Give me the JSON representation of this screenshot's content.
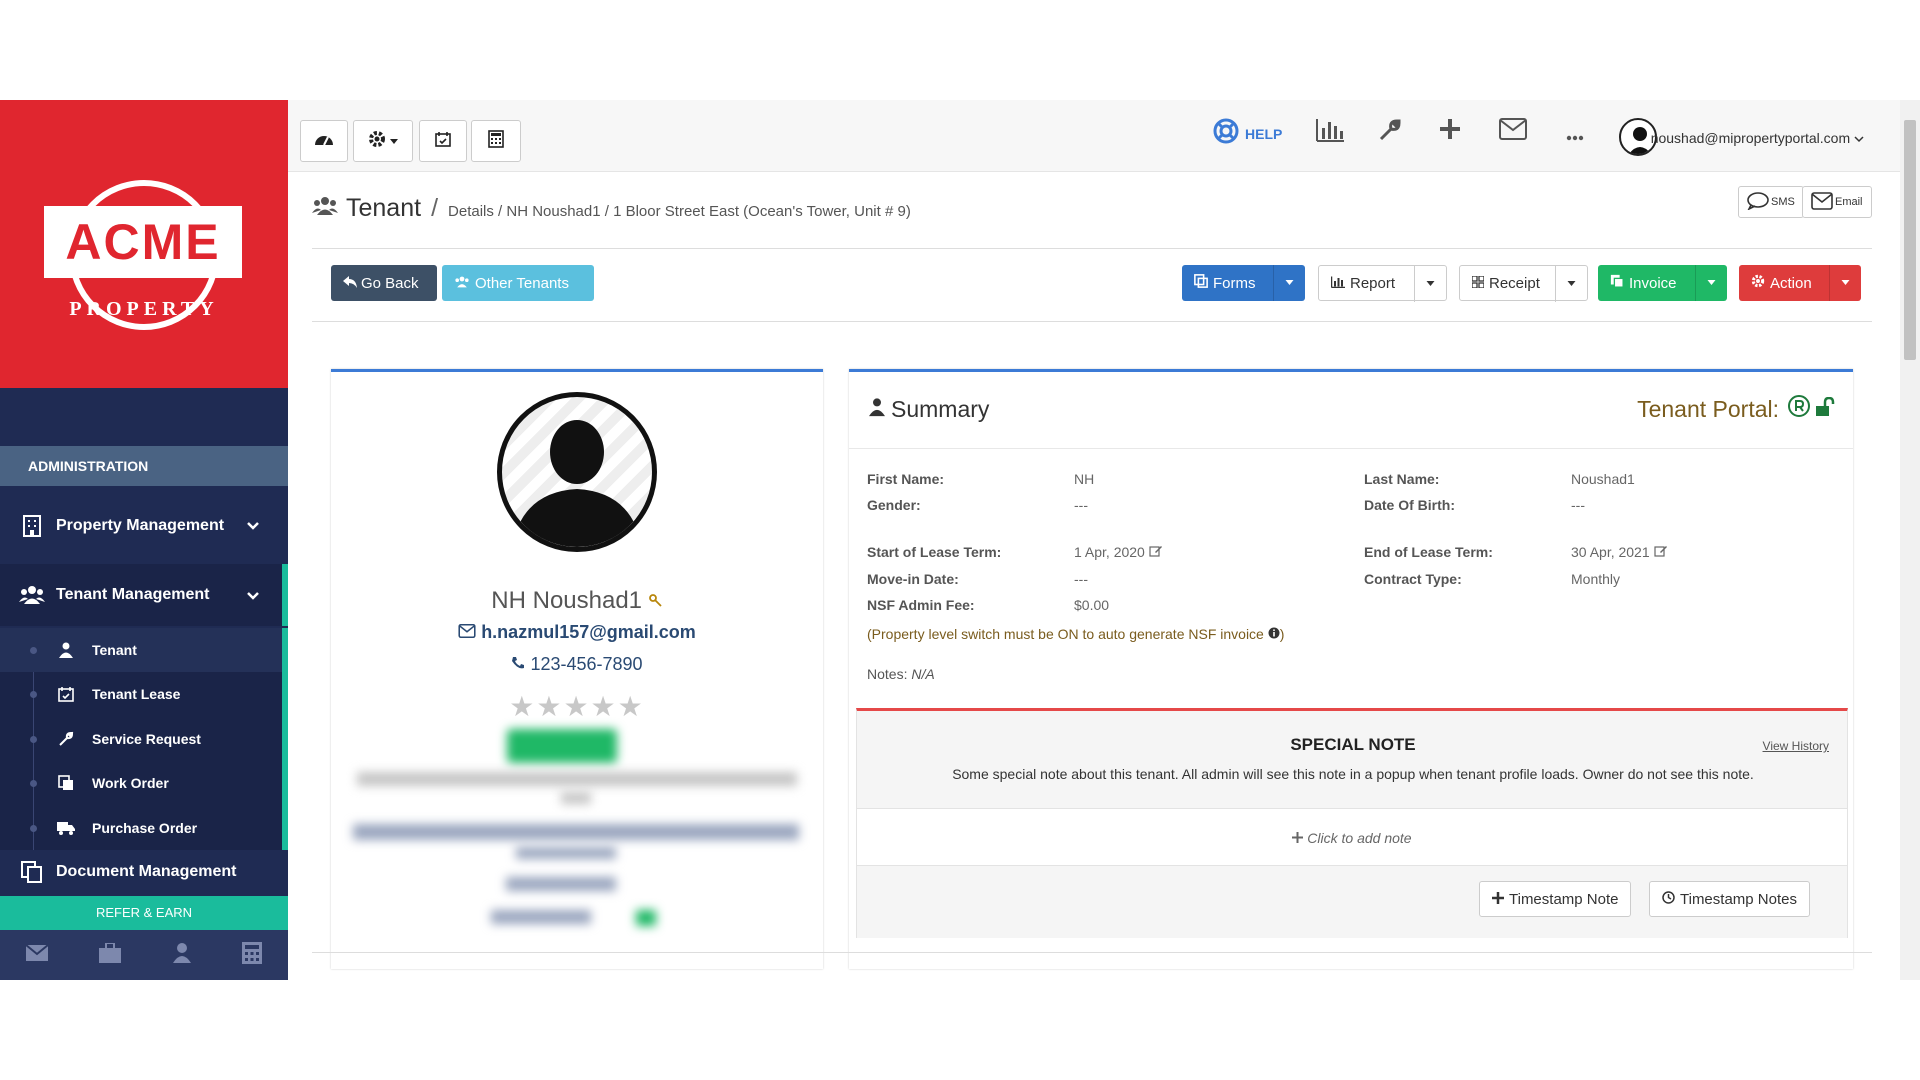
{
  "brand": {
    "name": "ACME",
    "sub": "PROPERTY",
    "accent": "#e0262f"
  },
  "sidebar": {
    "section": "ADMINISTRATION",
    "items": [
      {
        "label": "Property Management",
        "icon": "building-icon"
      },
      {
        "label": "Tenant Management",
        "icon": "users-icon"
      },
      {
        "label": "Document Management",
        "icon": "documents-icon"
      }
    ],
    "sub_items": [
      {
        "label": "Tenant",
        "icon": "user-icon"
      },
      {
        "label": "Tenant Lease",
        "icon": "calendar-check-icon"
      },
      {
        "label": "Service Request",
        "icon": "wrench-icon"
      },
      {
        "label": "Work Order",
        "icon": "copy-icon"
      },
      {
        "label": "Purchase Order",
        "icon": "truck-icon"
      }
    ],
    "refer": "REFER & EARN"
  },
  "topbar": {
    "help": "HELP",
    "user_email": "noushad@mipropertyportal.com"
  },
  "breadcrumb": {
    "title": "Tenant",
    "sep": "/",
    "rest": "Details / NH Noushad1 / 1 Bloor Street East (Ocean's Tower, Unit # 9)",
    "sms": "SMS",
    "email": "Email"
  },
  "actions": {
    "go_back": "Go Back",
    "other_tenants": "Other Tenants",
    "forms": "Forms",
    "report": "Report",
    "receipt": "Receipt",
    "invoice": "Invoice",
    "action": "Action"
  },
  "profile": {
    "name": "NH Noushad1",
    "email": "h.nazmul157@gmail.com",
    "phone": "123-456-7890",
    "stars": "★★★★★"
  },
  "summary": {
    "title": "Summary",
    "portal": "Tenant Portal:",
    "fields_left": [
      {
        "label": "First Name:",
        "value": "NH"
      },
      {
        "label": "Gender:",
        "value": "---"
      },
      {
        "label": "Start of Lease Term:",
        "value": "1 Apr, 2020"
      },
      {
        "label": "Move-in Date:",
        "value": "---"
      },
      {
        "label": "NSF Admin Fee:",
        "value": "$0.00"
      }
    ],
    "fields_right": [
      {
        "label": "Last Name:",
        "value": "Noushad1"
      },
      {
        "label": "Date Of Birth:",
        "value": "---"
      },
      {
        "label": "End of Lease Term:",
        "value": "30 Apr, 2021"
      },
      {
        "label": "Contract Type:",
        "value": "Monthly"
      }
    ],
    "nsf_note": "(Property level switch must be ON to auto generate NSF invoice",
    "nsf_note_end": ")",
    "notes_label": "Notes:",
    "notes_value": "N/A"
  },
  "special_note": {
    "title": "SPECIAL NOTE",
    "history": "View History",
    "text": "Some special note about this tenant. All admin will see this note in a popup when tenant profile loads. Owner do not see this note.",
    "add": "Click to add note",
    "ts_note": "Timestamp Note",
    "ts_notes": "Timestamp Notes"
  }
}
